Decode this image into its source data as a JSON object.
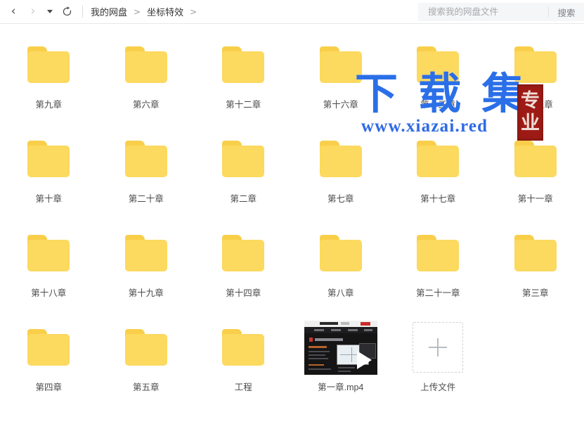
{
  "topbar": {
    "back_icon": "chevron-left-icon",
    "forward_icon": "chevron-right-icon",
    "history_caret_icon": "caret-down-icon",
    "refresh_icon": "refresh-icon",
    "breadcrumbs": [
      {
        "label": "我的网盘"
      },
      {
        "label": "坐标特效"
      }
    ],
    "breadcrumb_separator": ">",
    "trailing_separator": ">"
  },
  "search": {
    "placeholder": "搜索我的网盘文件",
    "value": "",
    "button_label": "搜索"
  },
  "grid": {
    "rows": [
      [
        {
          "type": "folder",
          "label": "第九章"
        },
        {
          "type": "folder",
          "label": "第六章"
        },
        {
          "type": "folder",
          "label": "第十二章"
        },
        {
          "type": "folder",
          "label": "第十六章"
        },
        {
          "type": "folder",
          "label": "第十三章"
        },
        {
          "type": "folder",
          "label": "第十五章"
        }
      ],
      [
        {
          "type": "folder",
          "label": "第十章"
        },
        {
          "type": "folder",
          "label": "第二十章"
        },
        {
          "type": "folder",
          "label": "第二章"
        },
        {
          "type": "folder",
          "label": "第七章"
        },
        {
          "type": "folder",
          "label": "第十七章"
        },
        {
          "type": "folder",
          "label": "第十一章"
        }
      ],
      [
        {
          "type": "folder",
          "label": "第十八章"
        },
        {
          "type": "folder",
          "label": "第十九章"
        },
        {
          "type": "folder",
          "label": "第十四章"
        },
        {
          "type": "folder",
          "label": "第八章"
        },
        {
          "type": "folder",
          "label": "第二十一章"
        },
        {
          "type": "folder",
          "label": "第三章"
        }
      ],
      [
        {
          "type": "folder",
          "label": "第四章"
        },
        {
          "type": "folder",
          "label": "第五章"
        },
        {
          "type": "folder",
          "label": "工程"
        },
        {
          "type": "video",
          "label": "第一章.mp4"
        },
        {
          "type": "upload",
          "label": "上传文件"
        }
      ]
    ]
  },
  "watermark": {
    "title": "下 载 集",
    "url": "www.xiazai.red",
    "seal_char_1": "专",
    "seal_char_2": "业"
  },
  "colors": {
    "folder_body": "#fcd95f",
    "folder_tab": "#f9cf4a",
    "watermark_blue": "#2b6fe8",
    "seal_red": "#9e1b15",
    "label_text": "#4b4b4b",
    "search_bg": "#f5f6f7"
  }
}
